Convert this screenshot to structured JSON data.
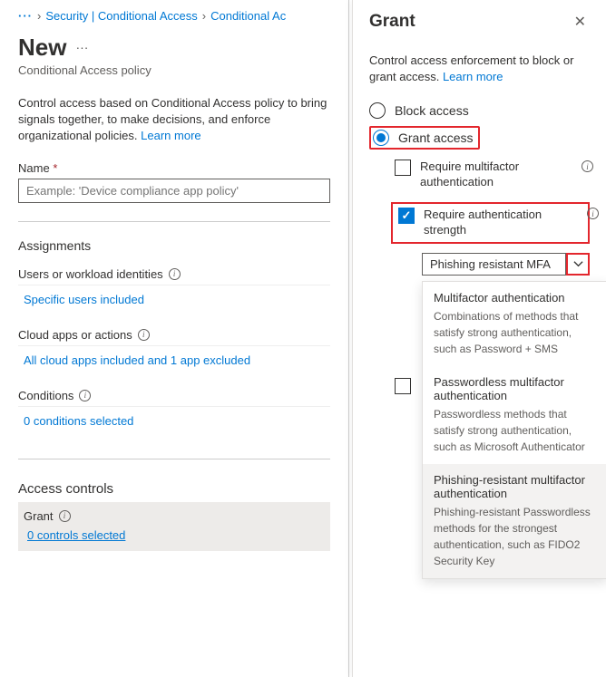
{
  "breadcrumb": {
    "item1": "Security | Conditional Access",
    "item2": "Conditional Ac"
  },
  "page": {
    "title": "New",
    "subtitle": "Conditional Access policy",
    "description": "Control access based on Conditional Access policy to bring signals together, to make decisions, and enforce organizational policies.",
    "learn_more": "Learn more"
  },
  "name_field": {
    "label": "Name",
    "placeholder": "Example: 'Device compliance app policy'"
  },
  "assignments": {
    "heading": "Assignments",
    "users_label": "Users or workload identities",
    "users_value": "Specific users included",
    "apps_label": "Cloud apps or actions",
    "apps_value": "All cloud apps included and 1 app excluded",
    "conditions_label": "Conditions",
    "conditions_value": "0 conditions selected"
  },
  "access_controls": {
    "heading": "Access controls",
    "grant_label": "Grant",
    "grant_value": "0 controls selected"
  },
  "panel": {
    "title": "Grant",
    "description": "Control access enforcement to block or grant access.",
    "learn_more": "Learn more",
    "block_label": "Block access",
    "grant_label": "Grant access",
    "req_mfa": "Require multifactor authentication",
    "req_strength": "Require authentication strength",
    "dropdown_value": "Phishing resistant MFA",
    "lower_placeholder": "",
    "options": [
      {
        "title": "Multifactor authentication",
        "desc": "Combinations of methods that satisfy strong authentication, such as Password + SMS"
      },
      {
        "title": "Passwordless multifactor authentication",
        "desc": "Passwordless methods that satisfy strong authentication, such as Microsoft Authenticator"
      },
      {
        "title": "Phishing-resistant multifactor authentication",
        "desc": "Phishing-resistant Passwordless methods for the strongest authentication, such as FIDO2 Security Key"
      }
    ]
  }
}
